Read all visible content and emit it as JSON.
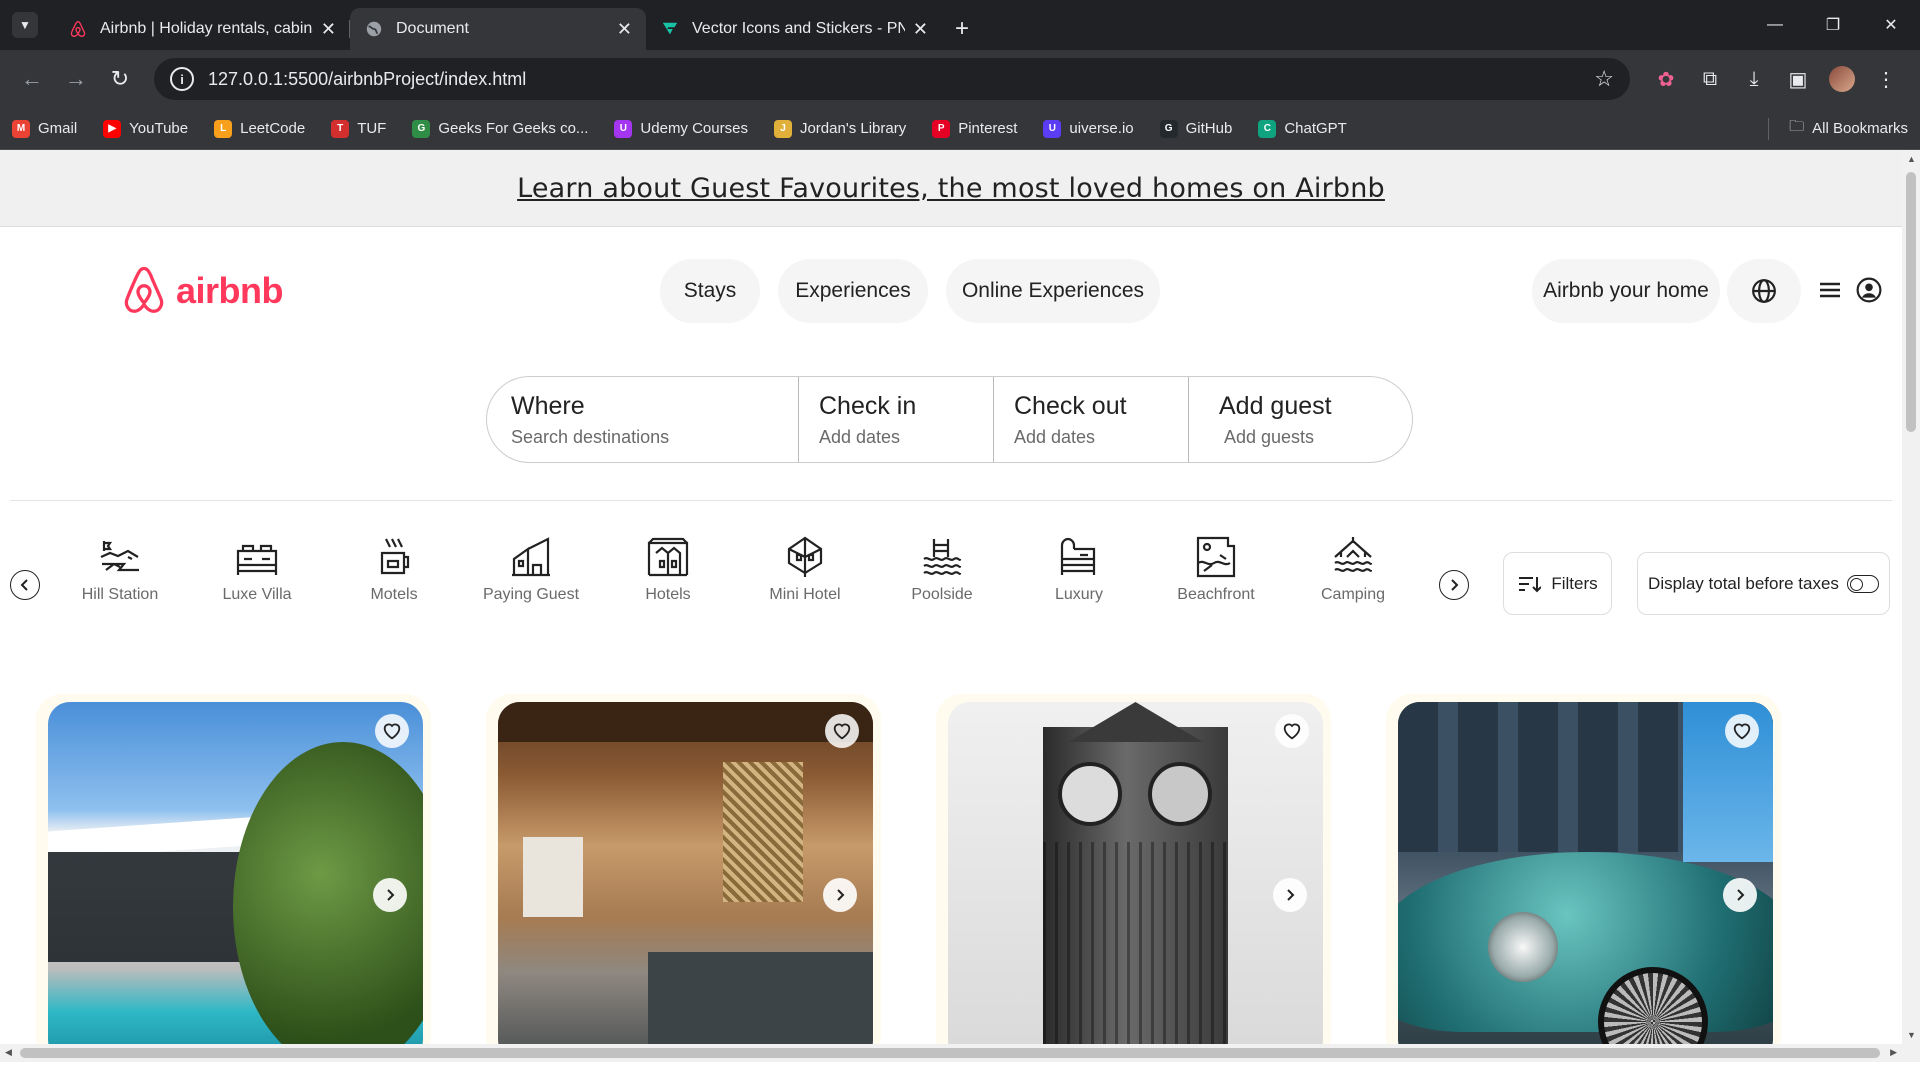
{
  "browser": {
    "tabs": [
      {
        "title": "Airbnb | Holiday rentals, cabins,",
        "favicon": "airbnb-icon"
      },
      {
        "title": "Document",
        "favicon": "globe-icon"
      },
      {
        "title": "Vector Icons and Stickers - PNG",
        "favicon": "flaticon-icon"
      }
    ],
    "new_tab": "+",
    "url": "127.0.0.1:5500/airbnbProject/index.html",
    "bookmarks": [
      {
        "label": "Gmail",
        "color": "#ea4335",
        "glyph": "M"
      },
      {
        "label": "YouTube",
        "color": "#ff0000",
        "glyph": "▶"
      },
      {
        "label": "LeetCode",
        "color": "#f89f1b",
        "glyph": "L"
      },
      {
        "label": "TUF",
        "color": "#d32f2f",
        "glyph": "T"
      },
      {
        "label": "Geeks For Geeks co...",
        "color": "#2f8d46",
        "glyph": "G"
      },
      {
        "label": "Udemy Courses",
        "color": "#a435f0",
        "glyph": "U"
      },
      {
        "label": "Jordan's Library",
        "color": "#e0b03a",
        "glyph": "J"
      },
      {
        "label": "Pinterest",
        "color": "#e60023",
        "glyph": "P"
      },
      {
        "label": "uiverse.io",
        "color": "#5b3df5",
        "glyph": "U"
      },
      {
        "label": "GitHub",
        "color": "#24292e",
        "glyph": "G"
      },
      {
        "label": "ChatGPT",
        "color": "#10a37f",
        "glyph": "C"
      }
    ],
    "all_bookmarks": "All Bookmarks"
  },
  "page": {
    "banner": "Learn about Guest Favourites, the most loved homes on Airbnb",
    "logo_text": "airbnb",
    "brand_color": "#ff385c",
    "nav": [
      "Stays",
      "Experiences",
      "Online Experiences"
    ],
    "host_link": "Airbnb your home",
    "search": [
      {
        "title": "Where",
        "sub": "Search destinations"
      },
      {
        "title": "Check in",
        "sub": "Add dates"
      },
      {
        "title": "Check out",
        "sub": "Add dates"
      },
      {
        "title": "Add guest",
        "sub": "Add guests"
      }
    ],
    "categories": [
      "Hill Station",
      "Luxe Villa",
      "Motels",
      "Paying Guest",
      "Hotels",
      "Mini Hotel",
      "Poolside",
      "Luxury",
      "Beachfront",
      "Camping"
    ],
    "filters": "Filters",
    "taxes_toggle": "Display total before taxes",
    "listings": [
      {
        "image": "modern-villa-photo"
      },
      {
        "image": "hotel-lobby-photo"
      },
      {
        "image": "big-ben-photo"
      },
      {
        "image": "vintage-car-photo"
      }
    ]
  }
}
